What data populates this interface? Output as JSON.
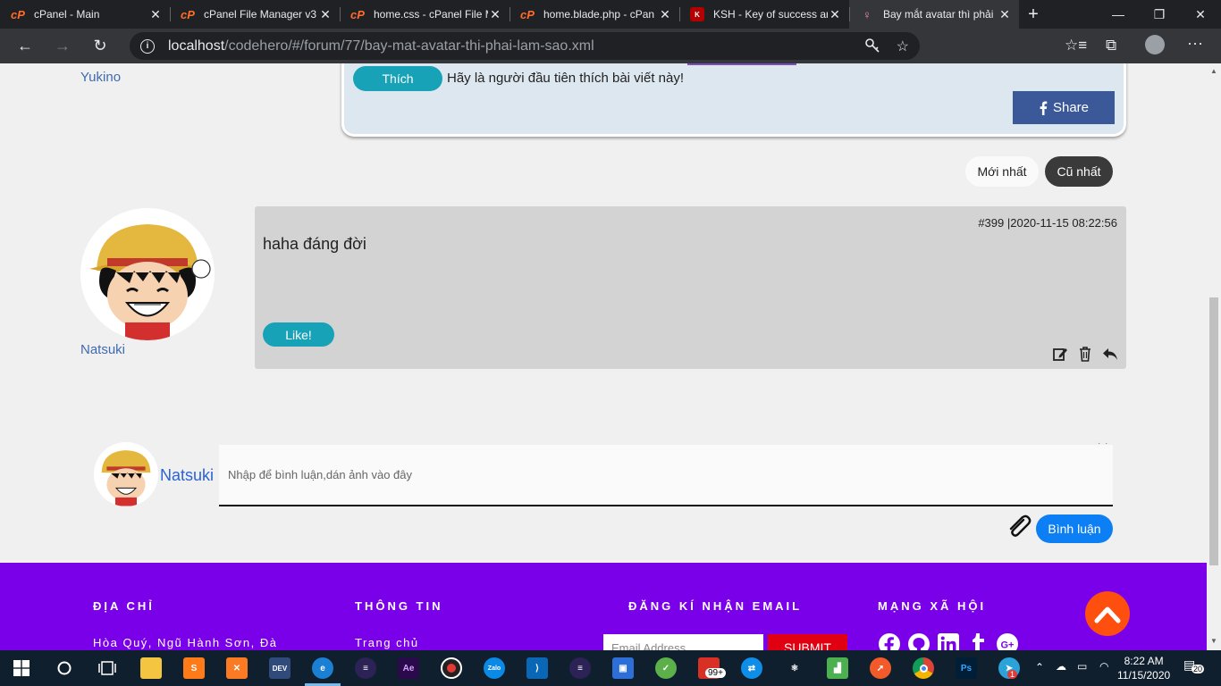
{
  "browser": {
    "tabs": [
      {
        "title": "cPanel - Main",
        "icon": "cpanel-icon",
        "active": false
      },
      {
        "title": "cPanel File Manager v3",
        "icon": "cpanel-icon",
        "active": false
      },
      {
        "title": "home.css - cPanel File M",
        "icon": "cpanel-icon",
        "active": false
      },
      {
        "title": "home.blade.php - cPan",
        "icon": "cpanel-icon",
        "active": false
      },
      {
        "title": "KSH - Key of success an",
        "icon": "ksh-icon",
        "active": false
      },
      {
        "title": "Bay mắt avatar thì phải",
        "icon": "pink-figure-icon",
        "active": true
      }
    ],
    "url_host": "localhost",
    "url_path": "/codehero/#/forum/77/bay-mat-avatar-thi-phai-lam-sao.xml"
  },
  "previous_post": {
    "username": "Yukino",
    "like_button": "Thích",
    "like_text": "Hãy là người đầu tiên thích bài viết này!",
    "share_button": "Share"
  },
  "sort": {
    "newest": "Mới nhất",
    "oldest": "Cũ nhất"
  },
  "comment": {
    "username": "Natsuki",
    "meta": "#399 |2020-11-15 08:22:56",
    "text": "haha đáng đời",
    "like_button": "Like!"
  },
  "composer": {
    "username": "Natsuki",
    "placeholder": "Nhập để bình luận,dán ảnh vào đây",
    "dots": "· ·",
    "submit": "Bình luận"
  },
  "footer": {
    "address_title": "ĐỊA CHỈ",
    "address_text": "Hòa Quý, Ngũ Hành Sơn, Đà",
    "info_title": "THÔNG TIN",
    "info_link": "Trang chủ",
    "newsletter_title": "ĐĂNG KÍ NHẬN EMAIL",
    "email_placeholder": "Email Address",
    "submit": "SUBMIT",
    "social_title": "MẠNG XÃ HỘI",
    "socials": [
      "facebook-icon",
      "github-icon",
      "linkedin-icon",
      "tumblr-icon",
      "google-plus-icon"
    ]
  },
  "taskbar": {
    "time": "8:22 AM",
    "date": "11/15/2020",
    "notifications": "20",
    "mail_badge": "99+",
    "telegram_badge": "1",
    "ext_d": "D"
  },
  "colors": {
    "footer_bg": "#7b00ea",
    "accent_teal": "#17a2b8",
    "facebook": "#3b5998",
    "comment_submit": "#0d7ff5",
    "to_top": "#ff4f0f"
  }
}
